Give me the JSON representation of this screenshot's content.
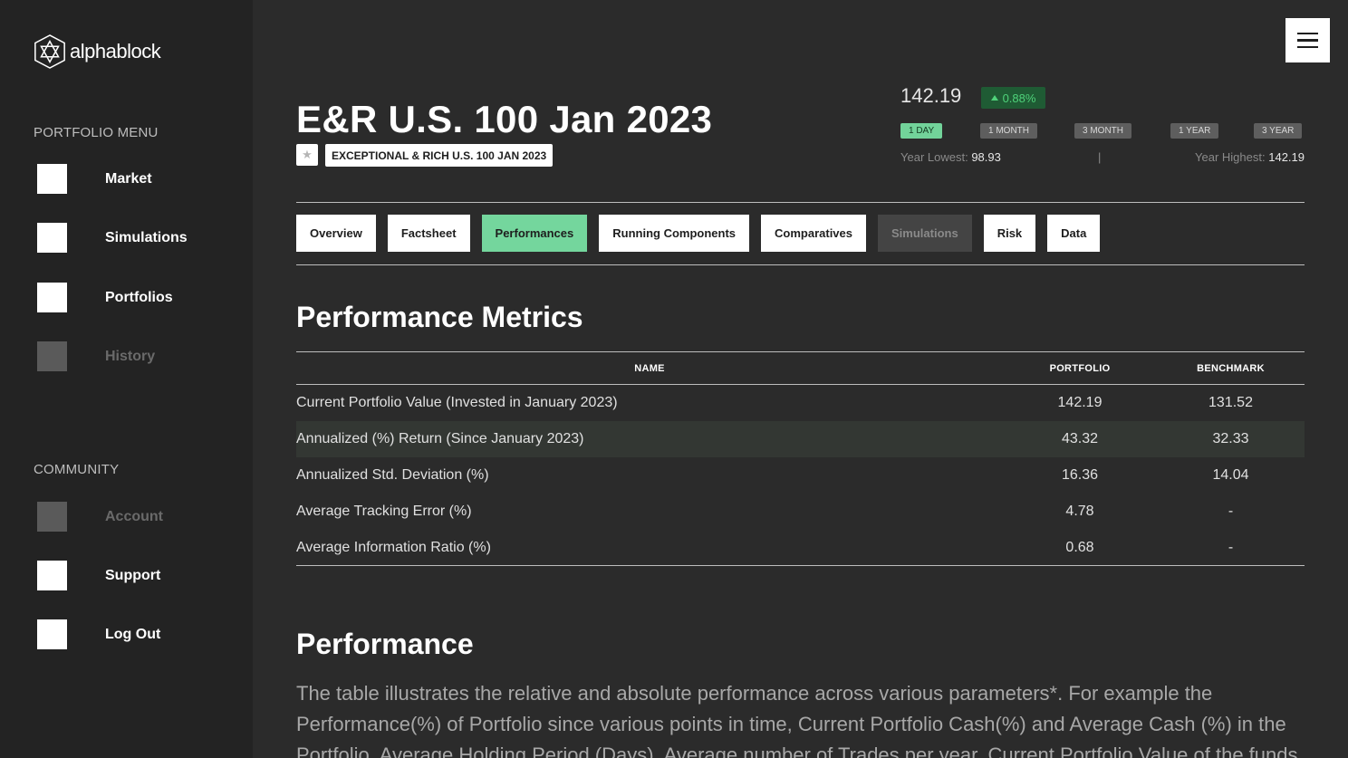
{
  "brand": {
    "name": "alphablock",
    "icon": "alphablock-logo-icon"
  },
  "sidebar": {
    "portfolio_menu_label": "PORTFOLIO MENU",
    "portfolio_items": [
      {
        "label": "Market",
        "enabled": true
      },
      {
        "label": "Simulations",
        "enabled": true
      },
      {
        "label": "Portfolios",
        "enabled": true
      },
      {
        "label": "History",
        "enabled": false
      }
    ],
    "community_label": "COMMUNITY",
    "community_items": [
      {
        "label": "Account",
        "enabled": false
      },
      {
        "label": "Support",
        "enabled": true
      },
      {
        "label": "Log Out",
        "enabled": true
      }
    ]
  },
  "header": {
    "menu_icon": "hamburger-menu-icon",
    "title": "E&R U.S. 100 Jan 2023",
    "favorite_icon": "star-icon",
    "subtitle": "EXCEPTIONAL & RICH U.S. 100 JAN 2023"
  },
  "quote": {
    "price": "142.19",
    "change": "0.88%",
    "change_direction_icon": "triangle-up-icon",
    "ranges": [
      "1 DAY",
      "1 MONTH",
      "3 MONTH",
      "1 YEAR",
      "3 YEAR"
    ],
    "active_range": "1 DAY",
    "year_low_label": "Year Lowest:",
    "year_low": "98.93",
    "separator": "|",
    "year_high_label": "Year Highest:",
    "year_high": "142.19"
  },
  "tabs": [
    {
      "label": "Overview",
      "state": "normal"
    },
    {
      "label": "Factsheet",
      "state": "normal"
    },
    {
      "label": "Performances",
      "state": "active"
    },
    {
      "label": "Running Components",
      "state": "normal"
    },
    {
      "label": "Comparatives",
      "state": "normal"
    },
    {
      "label": "Simulations",
      "state": "disabled"
    },
    {
      "label": "Risk",
      "state": "normal"
    },
    {
      "label": "Data",
      "state": "normal"
    }
  ],
  "metrics": {
    "heading": "Performance Metrics",
    "columns": [
      "NAME",
      "PORTFOLIO",
      "BENCHMARK"
    ],
    "rows": [
      {
        "name": "Current Portfolio Value (Invested in January 2023)",
        "portfolio": "142.19",
        "benchmark": "131.52"
      },
      {
        "name": "Annualized (%) Return (Since January 2023)",
        "portfolio": "43.32",
        "benchmark": "32.33"
      },
      {
        "name": "Annualized Std. Deviation (%)",
        "portfolio": "16.36",
        "benchmark": "14.04"
      },
      {
        "name": "Average Tracking Error (%)",
        "portfolio": "4.78",
        "benchmark": "-"
      },
      {
        "name": "Average Information Ratio (%)",
        "portfolio": "0.68",
        "benchmark": "-"
      }
    ]
  },
  "performance": {
    "heading": "Performance",
    "text": "The table illustrates the relative and absolute performance across various parameters*. For example the Performance(%) of Portfolio since various points in time, Current Portfolio Cash(%) and Average Cash (%) in the Portfolio, Average Holding Period (Days), Average number of Trades per year, Current Portfolio Value of the funds"
  },
  "colors": {
    "background": "#2b2b2b",
    "sidebar": "#232323",
    "accent_green": "#74d69d",
    "positive_text": "#4fd27a",
    "positive_bg": "#1f5b34"
  }
}
